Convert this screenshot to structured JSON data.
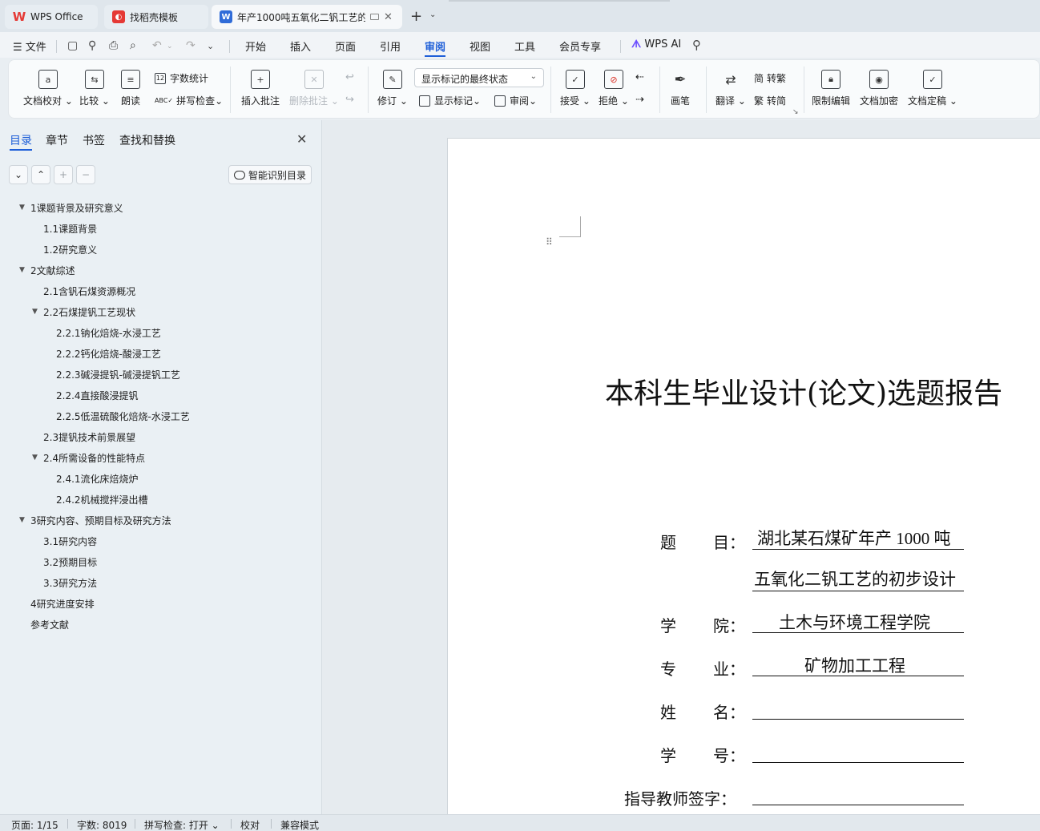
{
  "tabs": [
    {
      "label": "WPS Office",
      "icon": "wps-logo-icon",
      "color": "#e53935"
    },
    {
      "label": "找稻壳模板",
      "icon": "docer-icon",
      "color": "#e53935"
    },
    {
      "label": "年产1000吨五氧化二钒工艺的",
      "icon": "word-doc-icon",
      "color": "#2f6bd8"
    }
  ],
  "menu": {
    "file": "文件",
    "items": [
      "开始",
      "插入",
      "页面",
      "引用",
      "审阅",
      "视图",
      "工具",
      "会员专享"
    ],
    "active": "审阅",
    "wps_ai": "WPS AI"
  },
  "ribbon": {
    "doc_check": "文档校对",
    "compare": "比较",
    "read_aloud": "朗读",
    "word_count": "字数统计",
    "spell_check": "拼写检查",
    "insert_comment": "插入批注",
    "delete_comment": "删除批注",
    "track_changes": "修订",
    "markup_state": "显示标记的最终状态",
    "show_markup": "显示标记",
    "review": "审阅",
    "accept": "接受",
    "reject": "拒绝",
    "pen": "画笔",
    "translate": "翻译",
    "to_traditional": "转繁",
    "to_simplified": "转简",
    "restrict_edit": "限制编辑",
    "encrypt": "文档加密",
    "finalize": "文档定稿"
  },
  "nav": {
    "tabs": [
      "目录",
      "章节",
      "书签",
      "查找和替换"
    ],
    "smart_toc": "智能识别目录",
    "toc": [
      {
        "label": "1课题背景及研究意义",
        "level": 1,
        "expanded": true
      },
      {
        "label": "1.1课题背景",
        "level": 2
      },
      {
        "label": "1.2研究意义",
        "level": 2
      },
      {
        "label": "2文献综述",
        "level": 1,
        "expanded": true
      },
      {
        "label": "2.1含钒石煤资源概况",
        "level": 2
      },
      {
        "label": "2.2石煤提钒工艺现状",
        "level": 2,
        "expanded": true
      },
      {
        "label": "2.2.1钠化焙烧-水浸工艺",
        "level": 3
      },
      {
        "label": "2.2.2钙化焙烧-酸浸工艺",
        "level": 3
      },
      {
        "label": "2.2.3碱浸提钒-碱浸提钒工艺",
        "level": 3
      },
      {
        "label": "2.2.4直接酸浸提钒",
        "level": 3
      },
      {
        "label": "2.2.5低温硫酸化焙烧-水浸工艺",
        "level": 3
      },
      {
        "label": "2.3提钒技术前景展望",
        "level": 2
      },
      {
        "label": "2.4所需设备的性能特点",
        "level": 2,
        "expanded": true
      },
      {
        "label": "2.4.1流化床焙烧炉",
        "level": 3
      },
      {
        "label": "2.4.2机械搅拌浸出槽",
        "level": 3
      },
      {
        "label": "3研究内容、预期目标及研究方法",
        "level": 1,
        "expanded": true
      },
      {
        "label": "3.1研究内容",
        "level": 2
      },
      {
        "label": "3.2预期目标",
        "level": 2
      },
      {
        "label": "3.3研究方法",
        "level": 2
      },
      {
        "label": "4研究进度安排",
        "level": 1
      },
      {
        "label": "参考文献",
        "level": 1
      }
    ]
  },
  "document": {
    "title": "本科生毕业设计(论文)选题报告",
    "fields": {
      "topic_label_1": "题",
      "topic_label_2": "目：",
      "topic_line1": "湖北某石煤矿年产 1000 吨",
      "topic_line2": "五氧化二钒工艺的初步设计",
      "college_label_1": "学",
      "college_label_2": "院：",
      "college": "土木与环境工程学院",
      "major_label_1": "专",
      "major_label_2": "业：",
      "major": "矿物加工工程",
      "name_label_1": "姓",
      "name_label_2": "名：",
      "id_label_1": "学",
      "id_label_2": "号：",
      "advisor_label": "指导教师签字："
    }
  },
  "status": {
    "page": "页面: 1/15",
    "words": "字数: 8019",
    "spell": "拼写检查: 打开",
    "proof": "校对",
    "compat": "兼容模式"
  }
}
